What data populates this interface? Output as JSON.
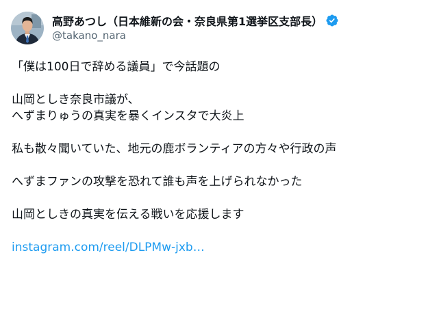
{
  "author": {
    "display_name": "高野あつし（日本維新の会・奈良県第1選挙区支部長）",
    "handle": "@takano_nara",
    "verified": true,
    "verified_badge_color": "#1d9bf0"
  },
  "tweet": {
    "lines": [
      "「僕は100日で辞める議員」で今話題の",
      "",
      "山岡としき奈良市議が、",
      "へずまりゅうの真実を暴くインスタで大炎上",
      "",
      "私も散々聞いていた、地元の鹿ボランティアの方々や行政の声",
      "",
      "へずまファンの攻撃を恐れて誰も声を上げられなかった",
      "",
      "山岡としきの真実を伝える戦いを応援します",
      ""
    ],
    "link_text": "instagram.com/reel/DLPMw-jxb…",
    "link_color": "#1d9bf0"
  },
  "colors": {
    "text": "#0f1419",
    "secondary": "#536471",
    "background": "#ffffff"
  }
}
